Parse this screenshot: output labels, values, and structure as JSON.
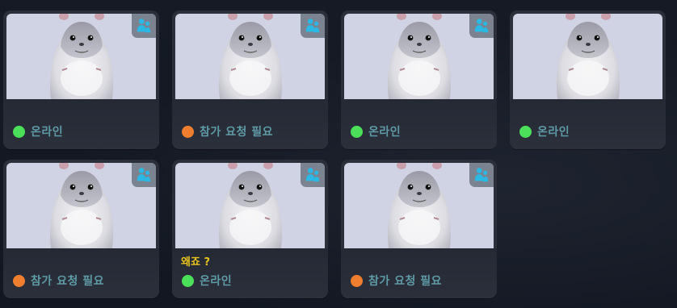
{
  "colors": {
    "online": "#4ce05a",
    "pending": "#ef7f2f",
    "status_text": "#5f9aa7",
    "note_text": "#e9c31d",
    "thumbnail_bg": "#d0d3e3"
  },
  "icons": {
    "avatar": "hamster-avatar-icon",
    "badge": "people-icon"
  },
  "players": [
    {
      "status": "online",
      "status_label": "온라인",
      "has_badge": true,
      "note": ""
    },
    {
      "status": "pending",
      "status_label": "참가 요청 필요",
      "has_badge": true,
      "note": ""
    },
    {
      "status": "online",
      "status_label": "온라인",
      "has_badge": true,
      "note": ""
    },
    {
      "status": "online",
      "status_label": "온라인",
      "has_badge": false,
      "note": ""
    },
    {
      "status": "pending",
      "status_label": "참가 요청 필요",
      "has_badge": true,
      "note": ""
    },
    {
      "status": "online",
      "status_label": "온라인",
      "has_badge": true,
      "note": "왜죠 ?"
    },
    {
      "status": "pending",
      "status_label": "참가 요청 필요",
      "has_badge": true,
      "note": ""
    }
  ]
}
